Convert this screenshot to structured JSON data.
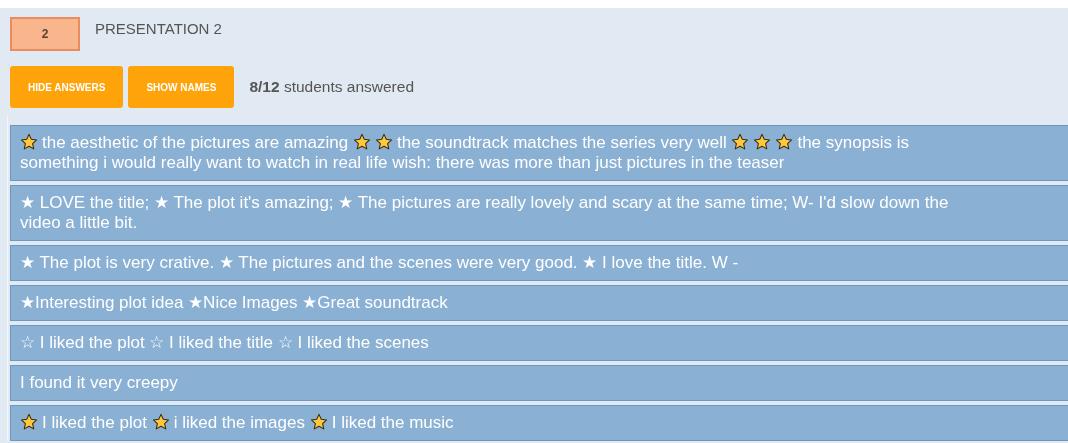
{
  "badge": "2",
  "title": "PRESENTATION 2",
  "buttons": [
    "HIDE ANSWERS",
    "SHOW NAMES"
  ],
  "summary": {
    "count": "8/12",
    "text": "students answered"
  },
  "answers": [
    [
      {
        "kind": "star"
      },
      {
        "kind": "text",
        "text": "the aesthetic of the pictures are amazing"
      },
      {
        "kind": "star"
      },
      {
        "kind": "star"
      },
      {
        "kind": "text",
        "text": "the soundtrack matches the series very well"
      },
      {
        "kind": "star"
      },
      {
        "kind": "star"
      },
      {
        "kind": "star"
      },
      {
        "kind": "text",
        "text": "the synopsis is"
      },
      {
        "kind": "text",
        "text": "something i would really want to watch in real life wish: there was more than just pictures in the teaser"
      }
    ],
    [
      {
        "kind": "text",
        "text": "★ LOVE the title; ★ The plot it's amazing; ★ The pictures are really lovely and scary at the same time; W- I'd slow down the"
      },
      {
        "kind": "text",
        "text": "video a little bit."
      }
    ],
    [
      {
        "kind": "text",
        "text": "★ The plot is very crative. ★ The pictures and the scenes were very good. ★ I love the title. W -"
      }
    ],
    [
      {
        "kind": "text",
        "text": "★Interesting plot idea ★Nice Images ★Great soundtrack"
      }
    ],
    [
      {
        "kind": "text",
        "text": "☆ I liked the plot ☆ I liked the title ☆ I liked the scenes"
      }
    ],
    [
      {
        "kind": "text",
        "text": "I found it very creepy"
      }
    ],
    [
      {
        "kind": "star"
      },
      {
        "kind": "text",
        "text": "I liked the plot"
      },
      {
        "kind": "star"
      },
      {
        "kind": "text",
        "text": "i liked the images"
      },
      {
        "kind": "star"
      },
      {
        "kind": "text",
        "text": "I liked the music"
      }
    ]
  ]
}
